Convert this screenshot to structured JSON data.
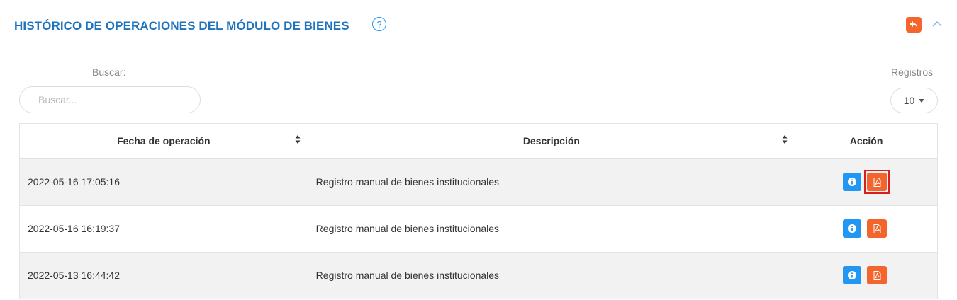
{
  "header": {
    "title": "HISTÓRICO DE OPERACIONES DEL MÓDULO DE BIENES",
    "help_symbol": "?"
  },
  "search": {
    "label": "Buscar:",
    "placeholder": "Buscar...",
    "value": ""
  },
  "records": {
    "label": "Registros",
    "selected": "10"
  },
  "table": {
    "columns": [
      "Fecha de operación",
      "Descripción",
      "Acción"
    ],
    "rows": [
      {
        "date": "2022-05-16 17:05:16",
        "description": "Registro manual de bienes institucionales"
      },
      {
        "date": "2022-05-16 16:19:37",
        "description": "Registro manual de bienes institucionales"
      },
      {
        "date": "2022-05-13 16:44:42",
        "description": "Registro manual de bienes institucionales"
      }
    ]
  },
  "colors": {
    "title": "#1e73be",
    "info_button": "#2196f3",
    "pdf_button": "#f4652e",
    "highlight": "#d42020"
  },
  "icons": [
    "help-icon",
    "back-icon",
    "chevron-up-icon",
    "sort-icon",
    "info-icon",
    "pdf-icon"
  ]
}
